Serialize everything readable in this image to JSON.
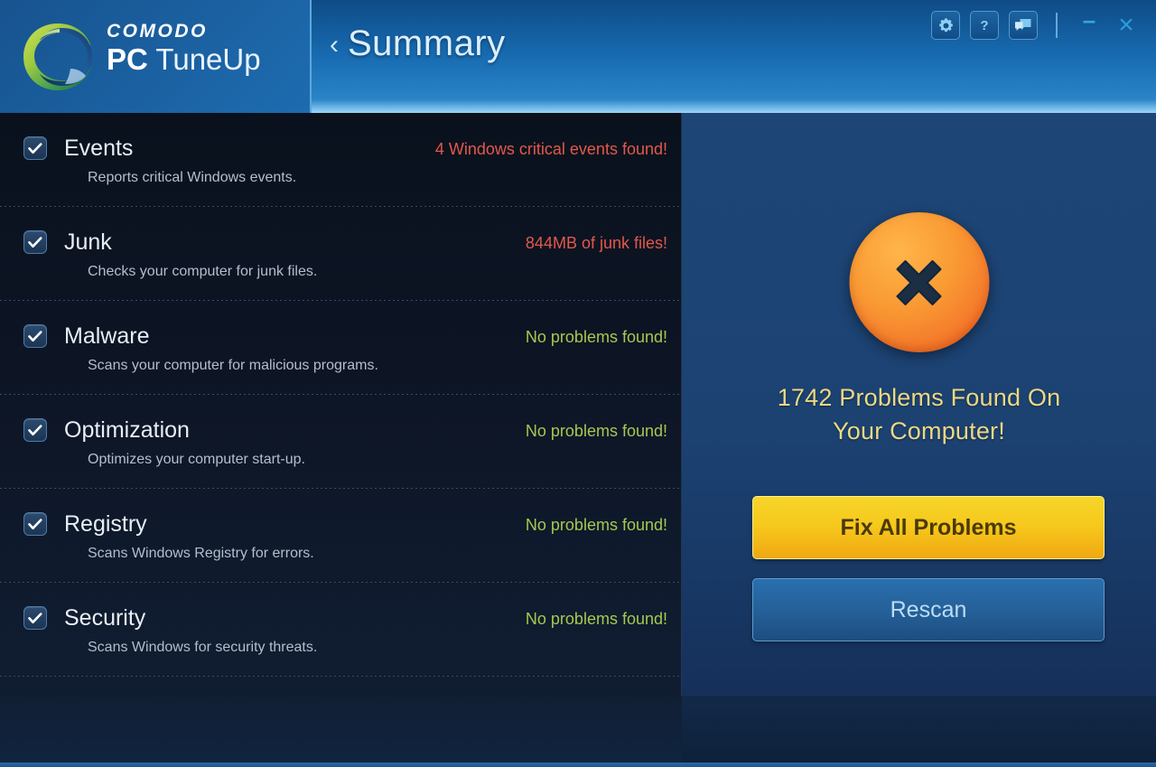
{
  "header": {
    "brand_top": "COMODO",
    "brand_product_bold": "PC",
    "brand_product_rest": " TuneUp",
    "logo_icon": "comodo-logo-icon",
    "page_title": "Summary",
    "back_chevron": "‹",
    "tool_buttons": [
      {
        "name": "settings-button",
        "icon": "gear-icon",
        "label": "Settings"
      },
      {
        "name": "help-button",
        "icon": "question-mark-icon",
        "label": "Help"
      },
      {
        "name": "feedback-button",
        "icon": "speech-bubble-icon",
        "label": "Feedback"
      }
    ],
    "window_buttons": [
      {
        "name": "minimize-button",
        "icon": "minimize-icon",
        "glyph": "–"
      },
      {
        "name": "close-button",
        "icon": "close-icon",
        "glyph": "×"
      }
    ]
  },
  "checklist": {
    "items": [
      {
        "id": "events",
        "label": "Events",
        "description": "Reports critical Windows events.",
        "status": "4 Windows critical events found!",
        "status_type": "bad",
        "checked": true
      },
      {
        "id": "junk",
        "label": "Junk",
        "description": "Checks your computer for junk files.",
        "status": "844MB of junk files!",
        "status_type": "bad",
        "checked": true
      },
      {
        "id": "malware",
        "label": "Malware",
        "description": "Scans your computer for malicious programs.",
        "status": "No problems found!",
        "status_type": "good",
        "checked": true
      },
      {
        "id": "optimization",
        "label": "Optimization",
        "description": "Optimizes your computer start-up.",
        "status": "No problems found!",
        "status_type": "good",
        "checked": true
      },
      {
        "id": "registry",
        "label": "Registry",
        "description": "Scans Windows Registry for errors.",
        "status": "No problems found!",
        "status_type": "good",
        "checked": true
      },
      {
        "id": "security",
        "label": "Security",
        "description": "Scans Windows for security threats.",
        "status": "No problems found!",
        "status_type": "good",
        "checked": true
      }
    ]
  },
  "summary_panel": {
    "status_icon": "error-x-circle-icon",
    "problem_count": 1742,
    "problems_line1": "1742 Problems Found On",
    "problems_line2": "Your Computer!",
    "fix_button_label": "Fix All Problems",
    "rescan_button_label": "Rescan"
  },
  "colors": {
    "accent_blue": "#2a84c8",
    "status_bad": "#e2594a",
    "status_good": "#a6c84f",
    "problem_text": "#ecd884",
    "fix_button": "#f6c81c",
    "badge_orange": "#f4742a",
    "left_panel_bg": "#0d1525",
    "right_panel_bg": "#1d4677"
  }
}
